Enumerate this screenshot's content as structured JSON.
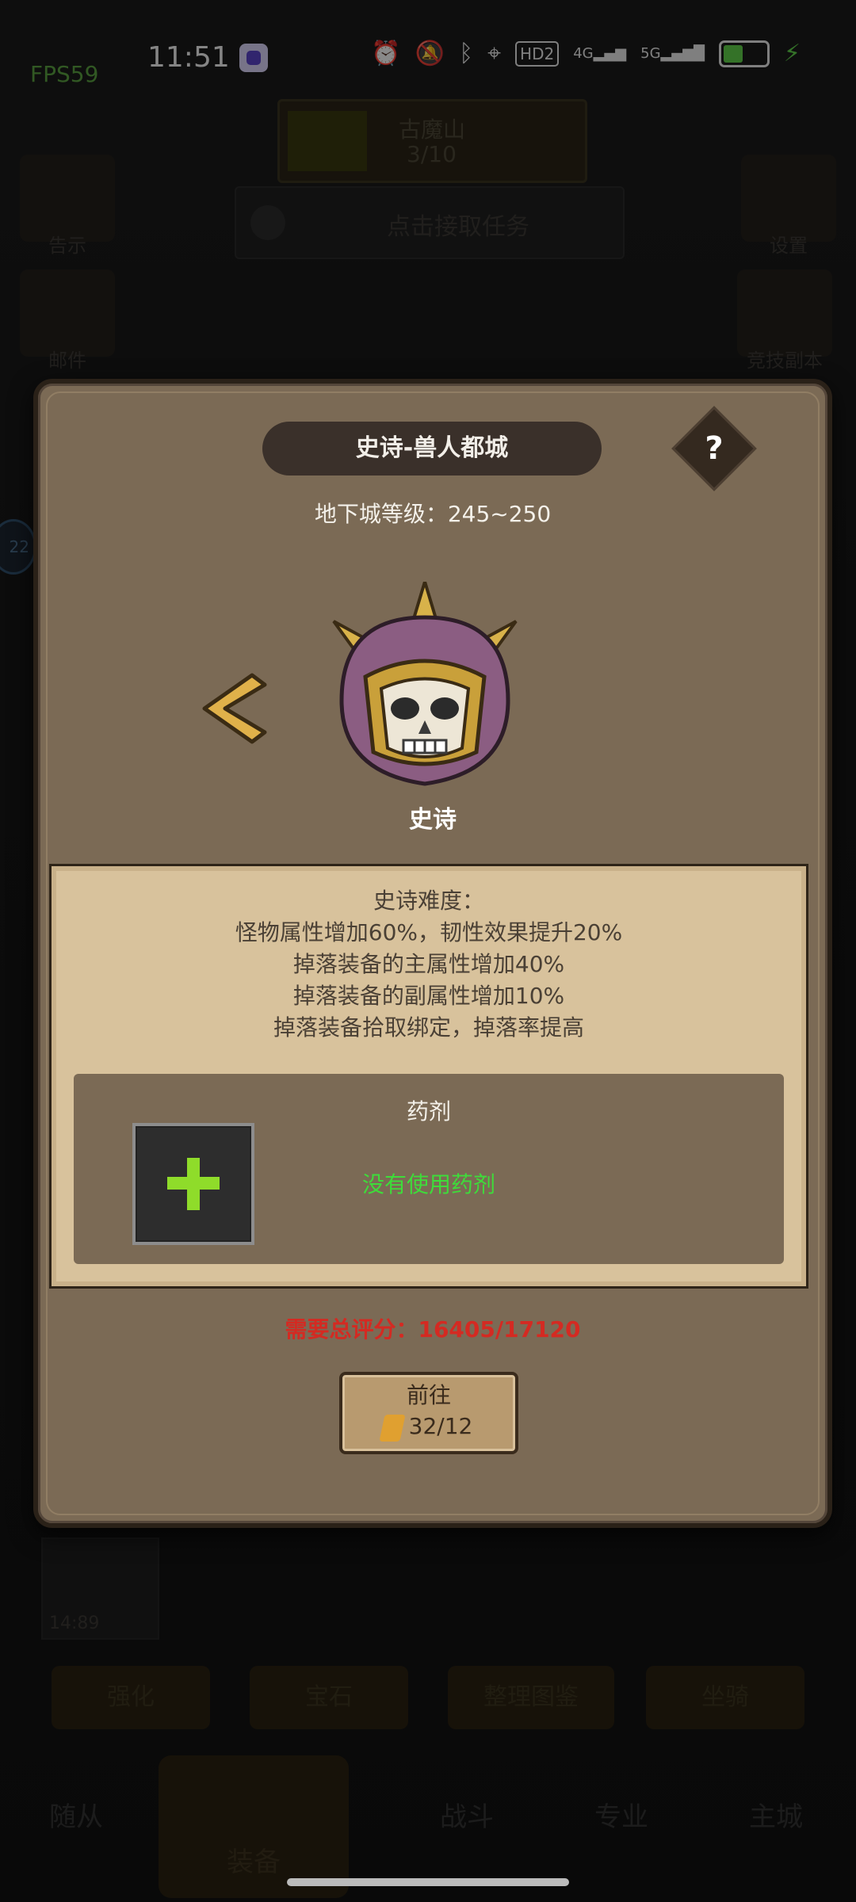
{
  "status_bar": {
    "fps": "FPS59",
    "time": "11:51",
    "hd_label": "HD2",
    "net1": "4G",
    "net2": "5G"
  },
  "background": {
    "stage_name": "古魔山",
    "stage_progress": "3/10",
    "task_hint": "点击接取任务",
    "left_top_label": "告示",
    "left_mid_label": "邮件",
    "right_top_label": "设置",
    "right_mid_label": "竞技副本",
    "badge": "22",
    "item_count": "14:89",
    "buttons": [
      "强化",
      "宝石",
      "整理图鉴",
      "坐骑"
    ],
    "tabs": [
      "随从",
      "装备",
      "战斗",
      "专业",
      "主城"
    ]
  },
  "modal": {
    "title": "史诗-兽人都城",
    "help": "?",
    "dungeon_level": "地下城等级：245~250",
    "difficulty_name": "史诗",
    "description": [
      "史诗难度：",
      "怪物属性增加60%，韧性效果提升20%",
      "掉落装备的主属性增加40%",
      "掉落装备的副属性增加10%",
      "掉落装备拾取绑定，掉落率提高"
    ],
    "potion_title": "药剂",
    "potion_status": "没有使用药剂",
    "required_score": "需要总评分：16405/17120",
    "go_label": "前往",
    "go_cost": "32/12"
  },
  "colors": {
    "accent_green": "#3edc3a",
    "warning_red": "#d42a22",
    "panel_brown": "#7b6a55",
    "parchment": "#d8c29c"
  }
}
